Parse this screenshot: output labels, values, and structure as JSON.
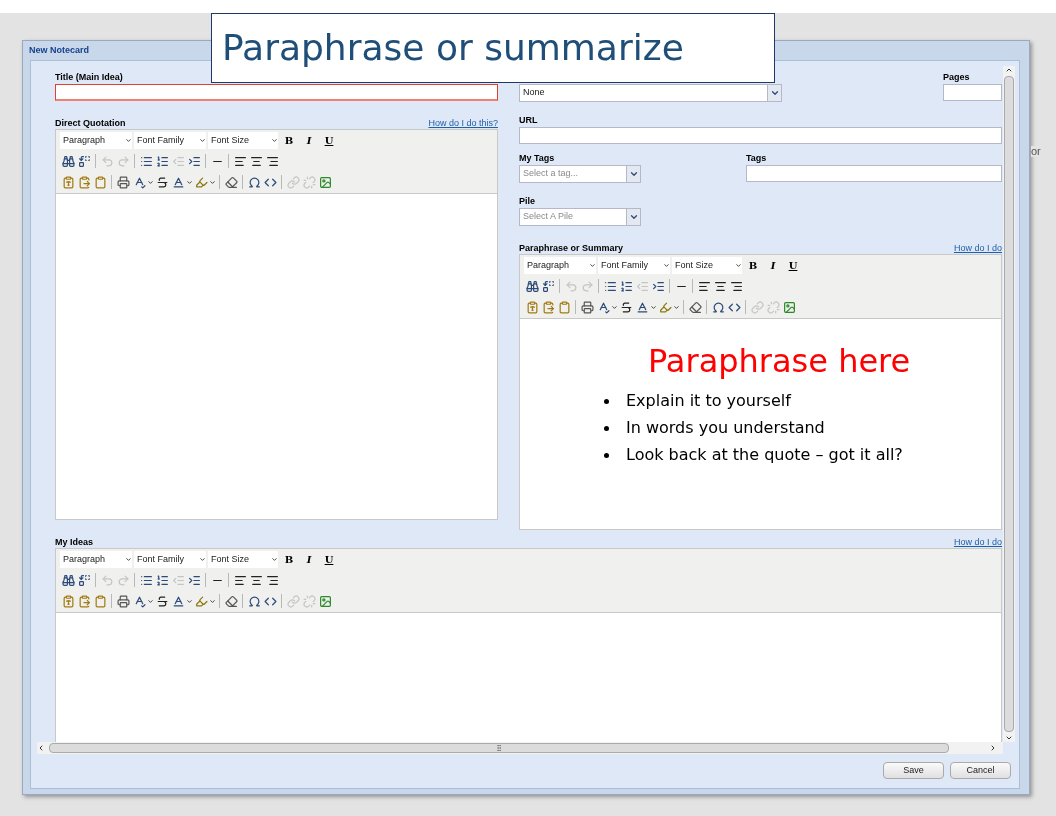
{
  "dialog": {
    "title": "New Notecard"
  },
  "callout": {
    "text": "Paraphrase or summarize"
  },
  "background_text": "or",
  "title_field": {
    "label": "Title (Main Idea)",
    "invalid": true
  },
  "source_select": {
    "value": "None"
  },
  "pages": {
    "label": "Pages"
  },
  "url": {
    "label": "URL"
  },
  "my_tags": {
    "label": "My Tags",
    "placeholder": "Select a tag..."
  },
  "tags": {
    "label": "Tags"
  },
  "pile": {
    "label": "Pile",
    "placeholder": "Select A Pile"
  },
  "editors": [
    {
      "label": "Direct Quotation",
      "help_link": "How do I do this?",
      "selects": [
        "Paragraph",
        "Font Family",
        "Font Size"
      ],
      "format_buttons": [
        "B",
        "I",
        "U"
      ]
    },
    {
      "label": "Paraphrase or Summary",
      "help_link": "How do I do",
      "selects": [
        "Paragraph",
        "Font Family",
        "Font Size"
      ],
      "format_buttons": [
        "B",
        "I",
        "U"
      ],
      "content": {
        "heading": "Paraphrase here",
        "bullets": [
          "Explain it to yourself",
          "In words you understand",
          "Look back at the quote – got it all?"
        ]
      }
    },
    {
      "label": "My Ideas",
      "help_link": "How do I do",
      "selects": [
        "Paragraph",
        "Font Family",
        "Font Size"
      ],
      "format_buttons": [
        "B",
        "I",
        "U"
      ]
    }
  ],
  "buttons": [
    {
      "label": "Save"
    },
    {
      "label": "Cancel"
    }
  ]
}
